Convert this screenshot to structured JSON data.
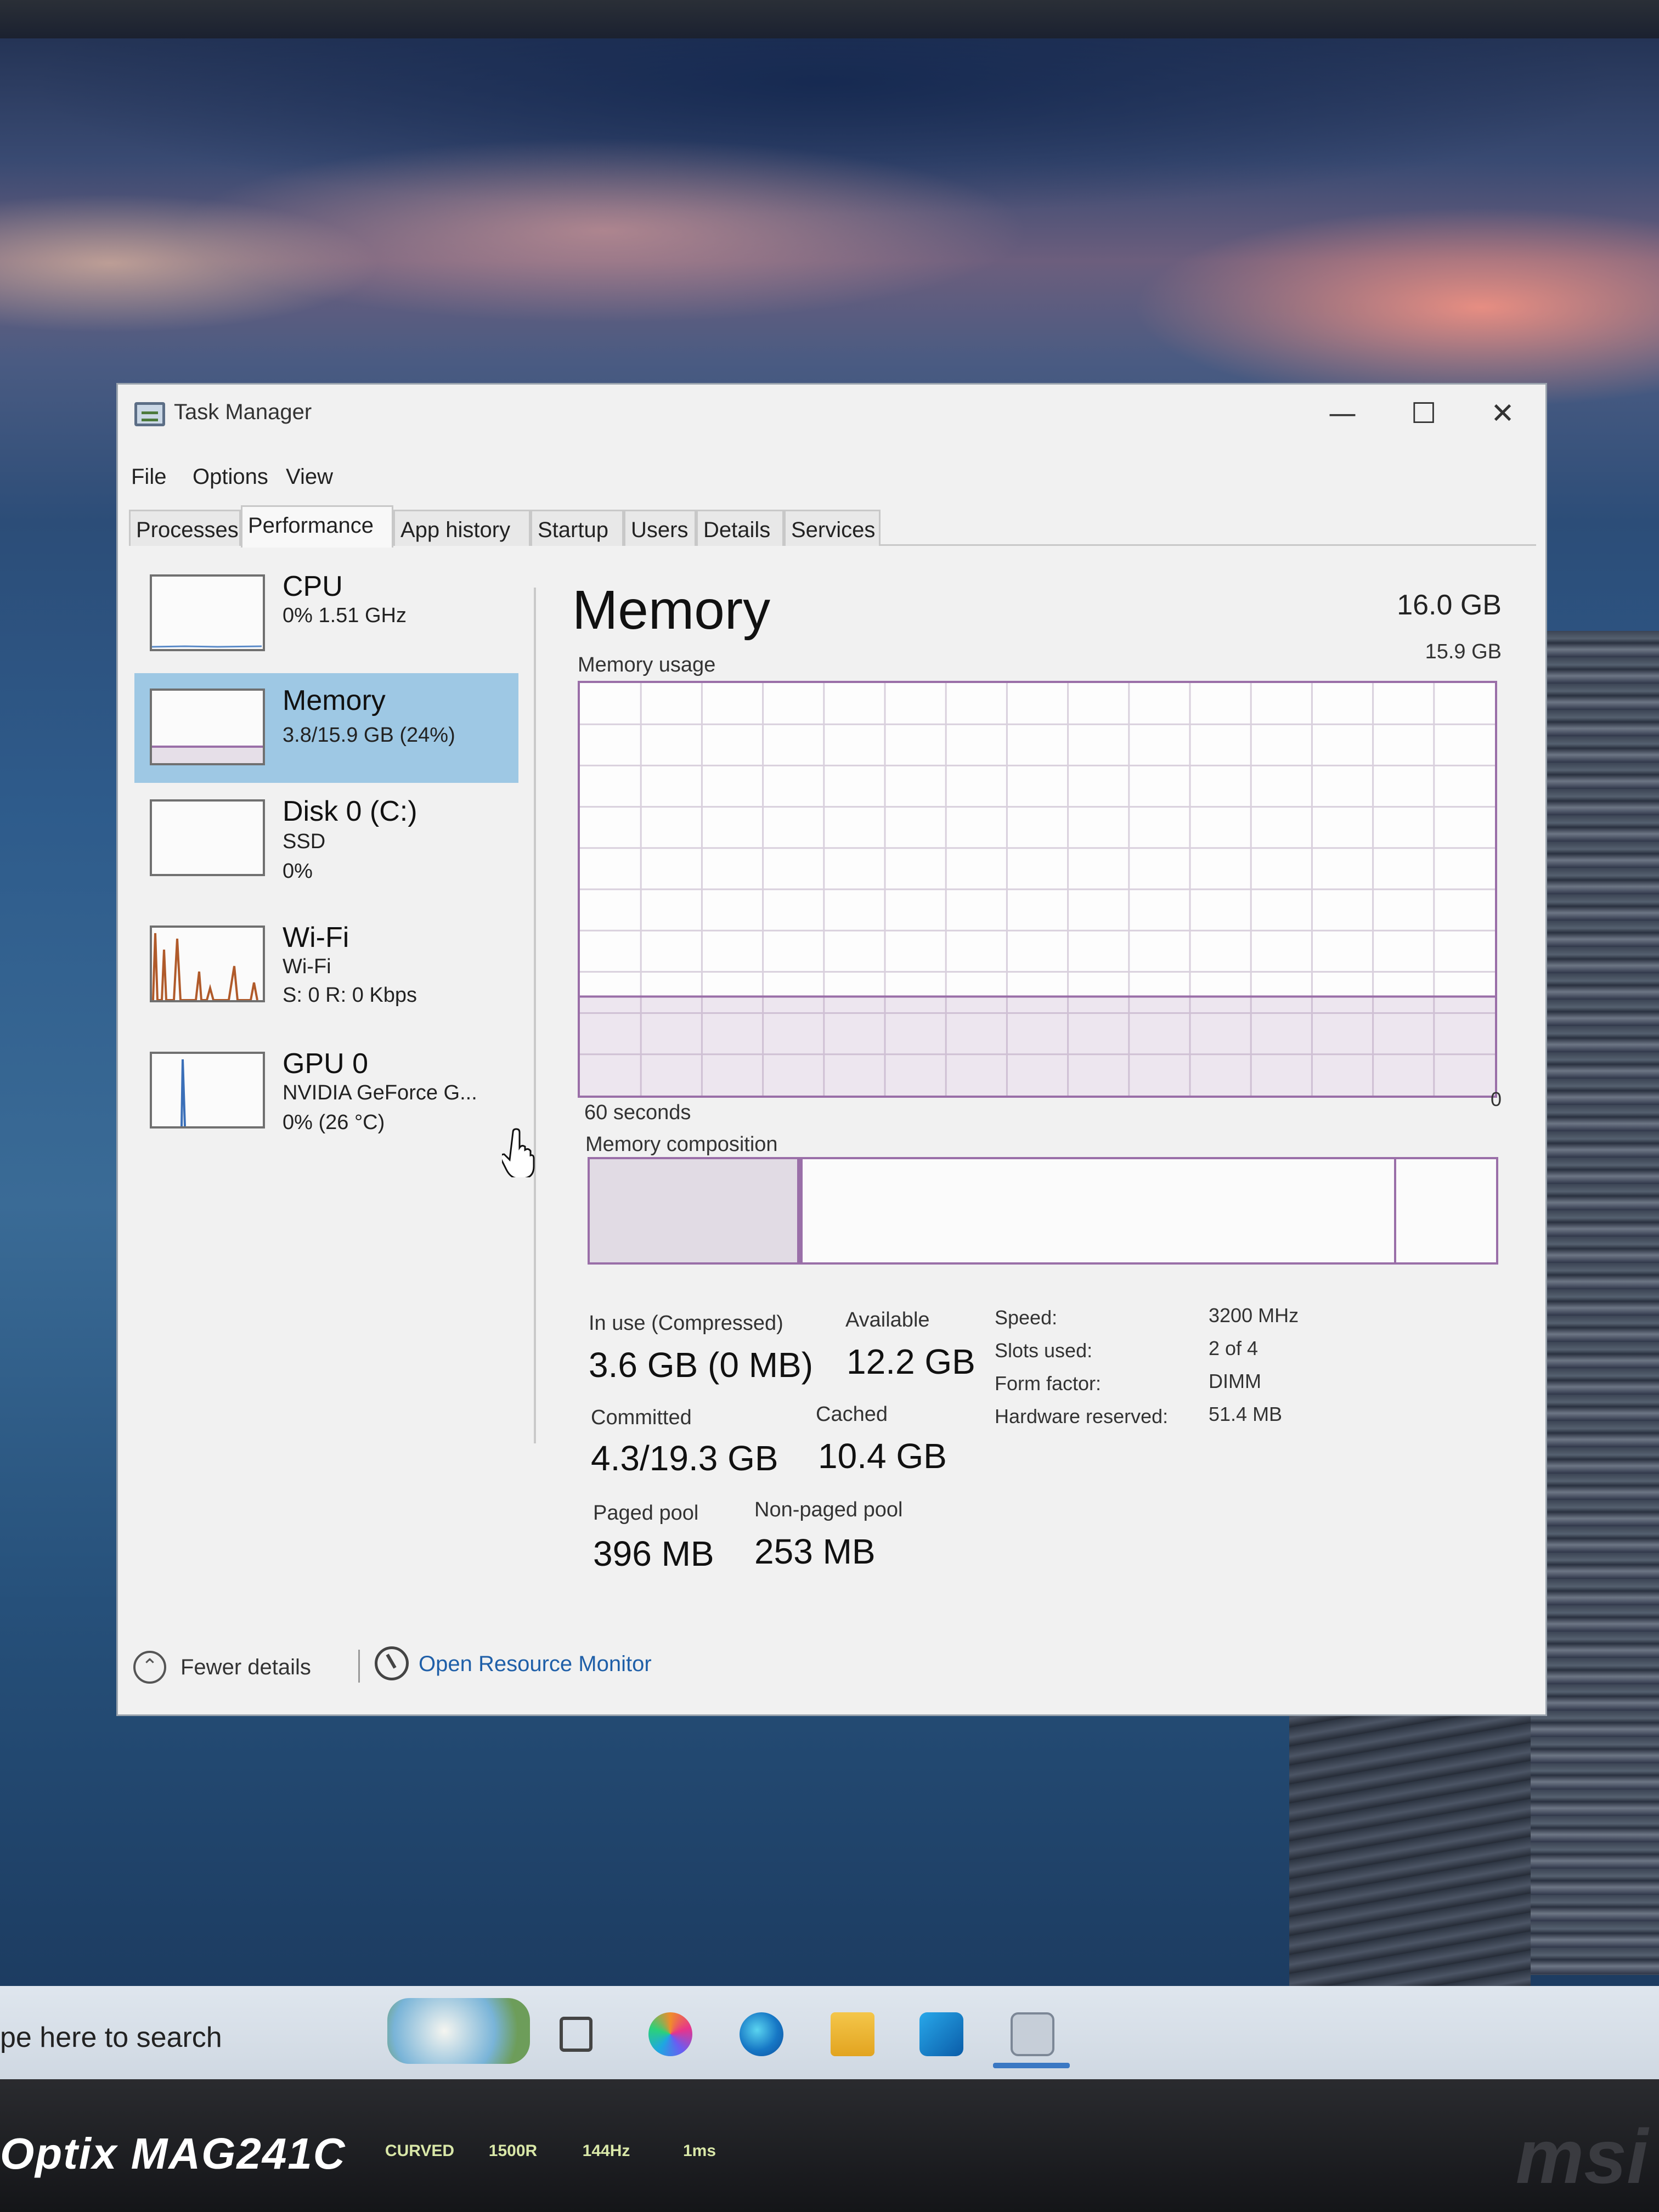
{
  "window": {
    "title": "Task Manager",
    "controls": {
      "minimize": "—",
      "maximize": "☐",
      "close": "✕"
    }
  },
  "menu": [
    "File",
    "Options",
    "View"
  ],
  "tabs": [
    {
      "label": "Processes",
      "active": false
    },
    {
      "label": "Performance",
      "active": true
    },
    {
      "label": "App history",
      "active": false
    },
    {
      "label": "Startup",
      "active": false
    },
    {
      "label": "Users",
      "active": false
    },
    {
      "label": "Details",
      "active": false
    },
    {
      "label": "Services",
      "active": false
    }
  ],
  "sidebar": {
    "items": [
      {
        "name": "CPU",
        "lines": [
          "0% 1.51 GHz"
        ],
        "selected": false
      },
      {
        "name": "Memory",
        "lines": [
          "3.8/15.9 GB (24%)"
        ],
        "selected": true
      },
      {
        "name": "Disk 0 (C:)",
        "lines": [
          "SSD",
          "0%"
        ],
        "selected": false
      },
      {
        "name": "Wi-Fi",
        "lines": [
          "Wi-Fi",
          "S: 0 R: 0 Kbps"
        ],
        "selected": false
      },
      {
        "name": "GPU 0",
        "lines": [
          "NVIDIA GeForce G...",
          "0% (26 °C)"
        ],
        "selected": false
      }
    ]
  },
  "memory": {
    "title": "Memory",
    "total_capacity": "16.0 GB",
    "usage_label": "Memory usage",
    "usage_max": "15.9 GB",
    "time_span": "60 seconds",
    "zero": "0",
    "usage_fraction": 0.24,
    "composition_label": "Memory composition",
    "composition": {
      "in_use_fraction": 0.235,
      "standby_fraction": 0.655,
      "free_fraction": 0.11
    },
    "stats": {
      "in_use_label": "In use (Compressed)",
      "in_use_value": "3.6 GB (0 MB)",
      "available_label": "Available",
      "available_value": "12.2 GB",
      "committed_label": "Committed",
      "committed_value": "4.3/19.3 GB",
      "cached_label": "Cached",
      "cached_value": "10.4 GB",
      "paged_pool_label": "Paged pool",
      "paged_pool_value": "396 MB",
      "non_paged_pool_label": "Non-paged pool",
      "non_paged_pool_value": "253 MB"
    },
    "specs": [
      {
        "label": "Speed:",
        "value": "3200 MHz"
      },
      {
        "label": "Slots used:",
        "value": "2 of 4"
      },
      {
        "label": "Form factor:",
        "value": "DIMM"
      },
      {
        "label": "Hardware reserved:",
        "value": "51.4 MB"
      }
    ]
  },
  "footer": {
    "fewer_details": "Fewer details",
    "open_resource_monitor": "Open Resource Monitor"
  },
  "taskbar": {
    "search_text": "pe here to search",
    "icons": [
      "task-view-icon",
      "copilot-icon",
      "edge-icon",
      "file-explorer-icon",
      "outlook-icon",
      "task-manager-icon"
    ]
  },
  "monitor": {
    "brand": "Optix MAG241C",
    "badges": [
      "CURVED",
      "1500R",
      "144Hz",
      "1ms"
    ]
  },
  "colors": {
    "accent_selected": "#9ec8e4",
    "memory_graph": "#9a6fa8",
    "link": "#1f5fa8"
  }
}
